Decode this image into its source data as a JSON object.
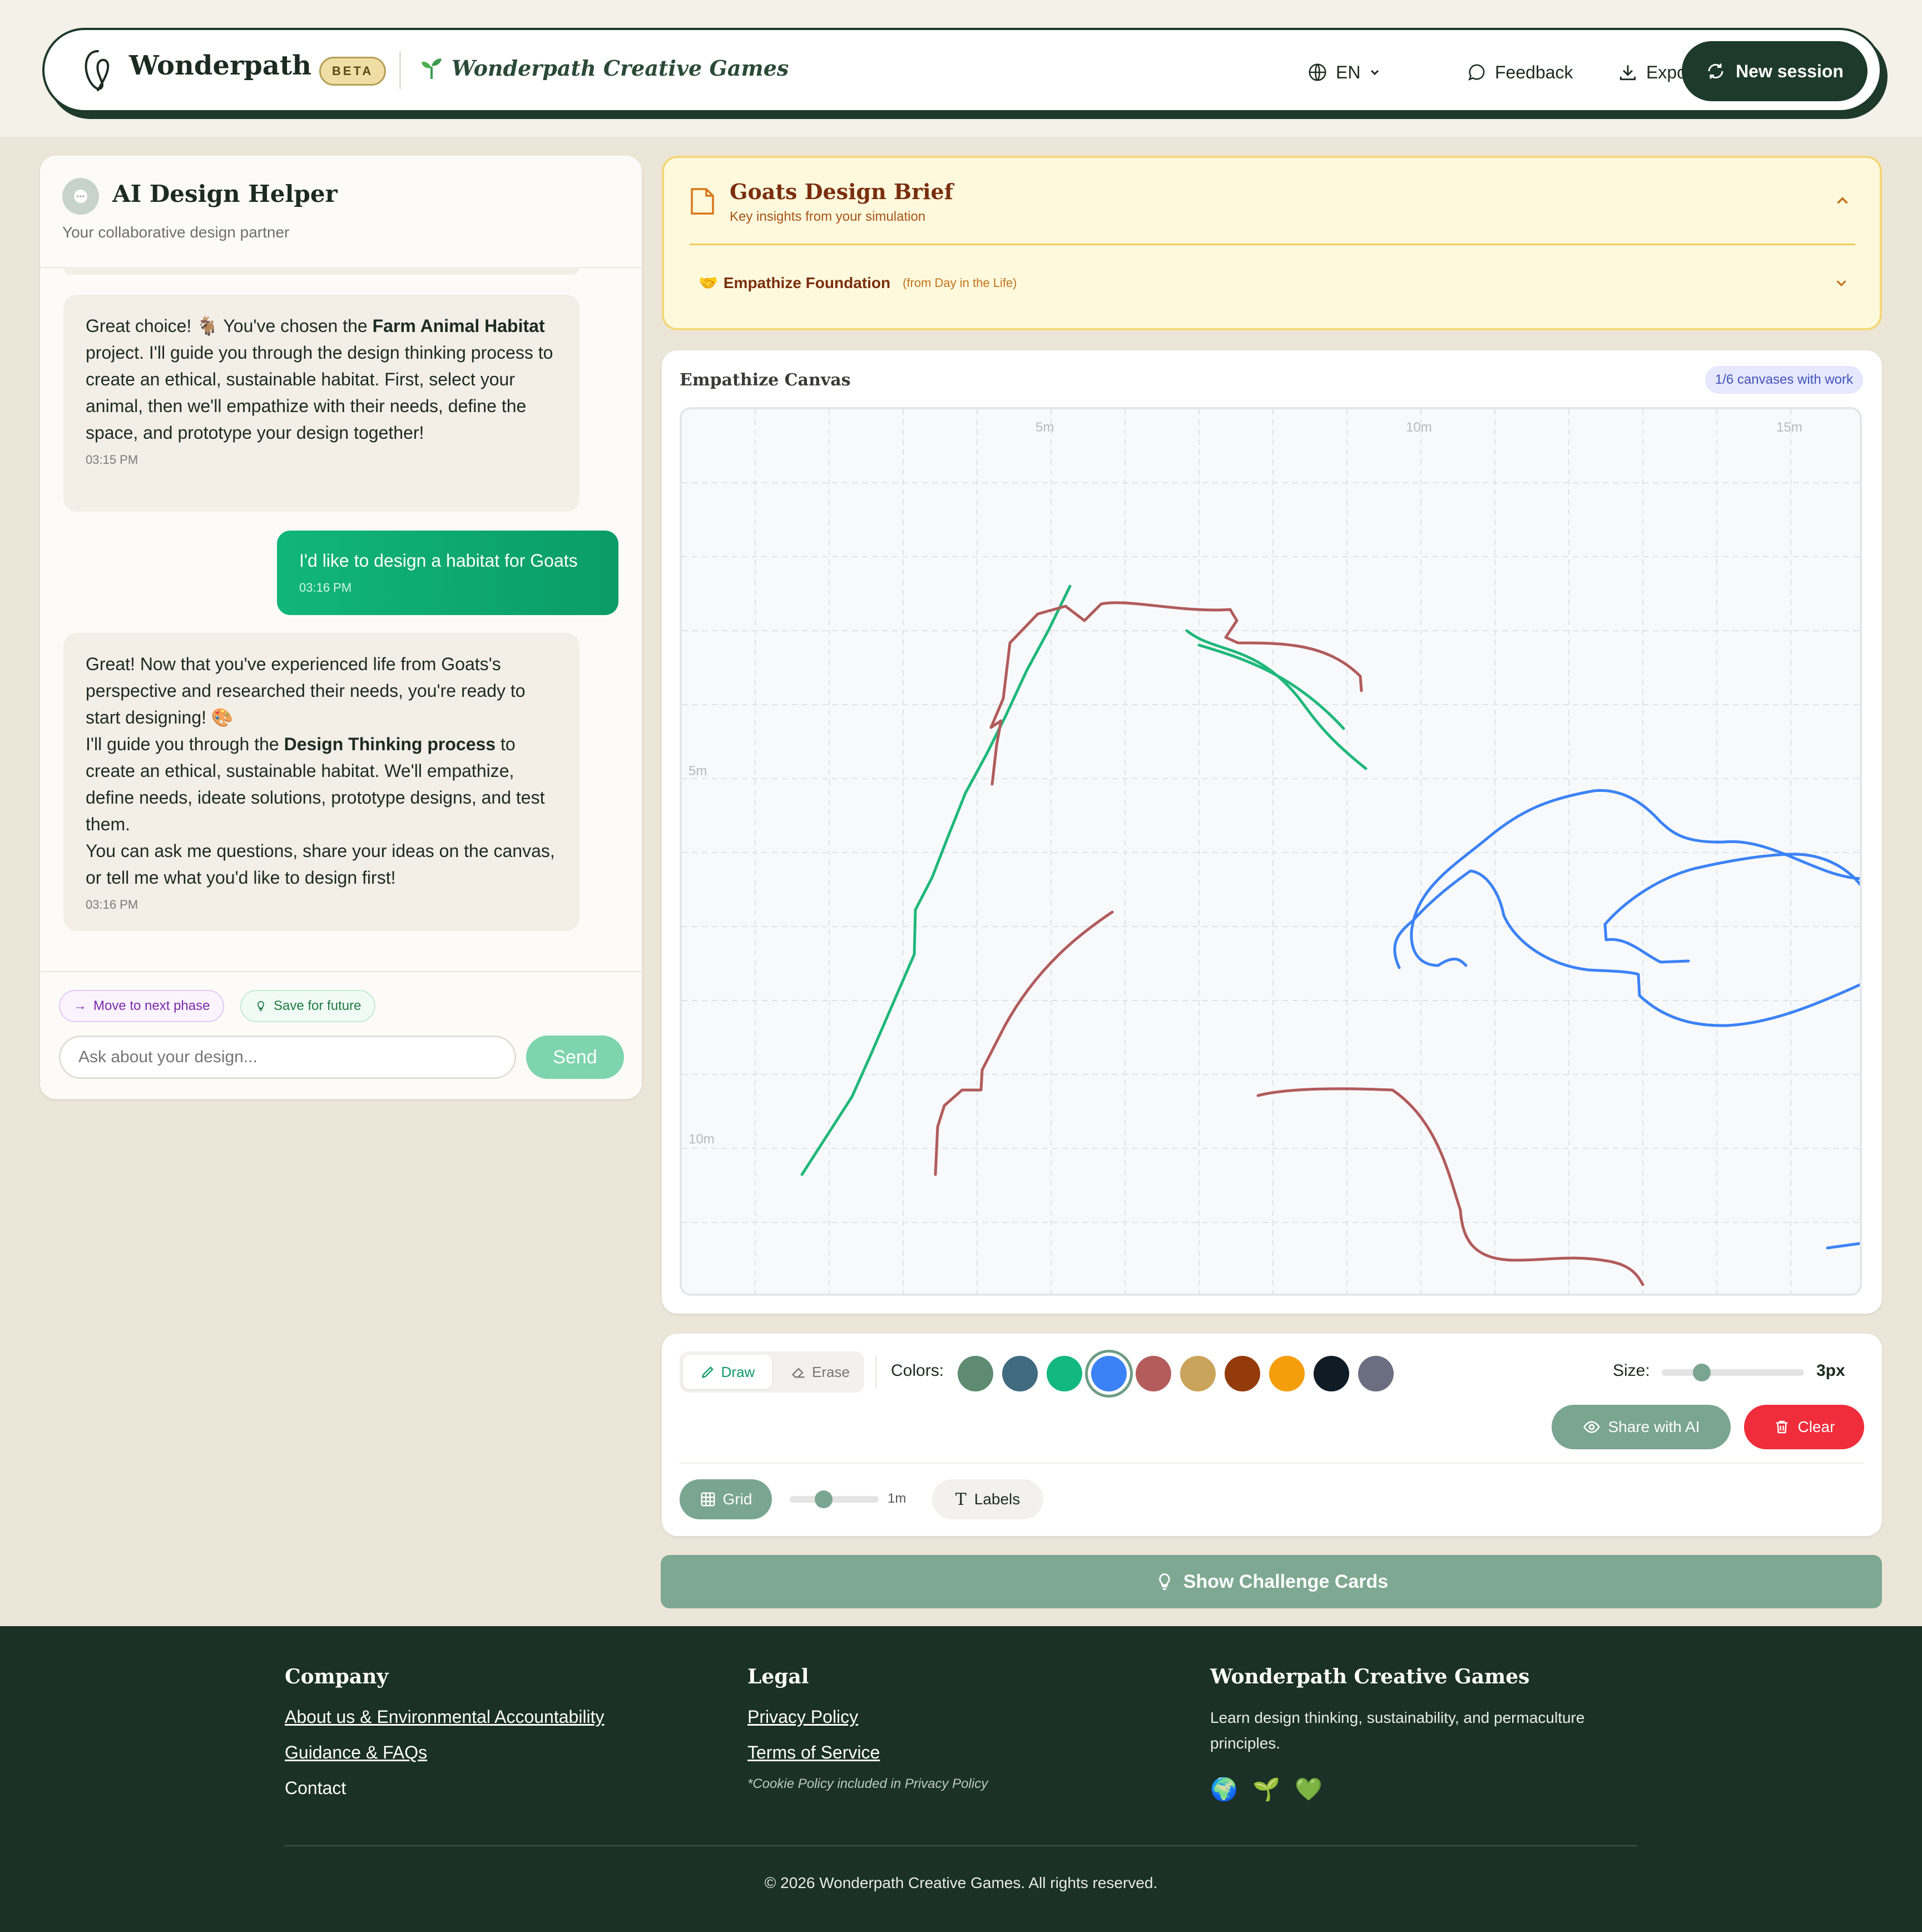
{
  "header": {
    "brand": "Wonderpath",
    "badge": "BETA",
    "subbrand": "Wonderpath Creative Games",
    "language": "EN",
    "feedback": "Feedback",
    "export": "Export",
    "new_session": "New session"
  },
  "chat": {
    "title": "AI Design Helper",
    "subtitle": "Your collaborative design partner",
    "messages": [
      {
        "role": "ai",
        "p1": "Great choice! 🐐 You've chosen the ",
        "b1": "Farm Animal Habitat",
        "p2": " project. I'll guide you through the design thinking process to create an ethical, sustainable habitat. First, select your animal, then we'll empathize with their needs, define the space, and prototype your design together!",
        "time": "03:15 PM"
      },
      {
        "role": "user",
        "text": "I'd like to design a habitat for Goats",
        "time": "03:16 PM"
      },
      {
        "role": "ai",
        "p1": "Great! Now that you've experienced life from Goats's perspective and researched their needs, you're ready to start designing! 🎨",
        "p2a": "I'll guide you through the ",
        "b2": "Design Thinking process",
        "p2b": " to create an ethical, sustainable habitat. We'll empathize, define needs, ideate solutions, prototype designs, and test them.",
        "p3": "You can ask me questions, share your ideas on the canvas, or tell me what you'd like to design first!",
        "time": "03:16 PM"
      }
    ],
    "chip_next": "Move to next phase",
    "chip_save": "Save for future",
    "input_placeholder": "Ask about your design...",
    "send": "Send"
  },
  "brief": {
    "title": "Goats Design Brief",
    "subtitle": "Key insights from your simulation",
    "item_emoji": "🤝",
    "item_label": "Empathize Foundation",
    "item_source": "(from Day in the Life)"
  },
  "canvas": {
    "title": "Empathize Canvas",
    "badge": "1/6 canvases with work",
    "ruler_x": [
      "5m",
      "10m",
      "15m"
    ],
    "ruler_y": [
      "5m",
      "10m"
    ]
  },
  "toolbar": {
    "draw": "Draw",
    "erase": "Erase",
    "colors_label": "Colors:",
    "colors": [
      "#5e8b72",
      "#3f6a80",
      "#12b880",
      "#3b82f6",
      "#b45c5c",
      "#c9a45a",
      "#943b0c",
      "#f59e0b",
      "#0f1c26",
      "#6b6e80"
    ],
    "selected_color": "#3b82f6",
    "size_label": "Size:",
    "size_value": "3px",
    "size_level": 0.25,
    "share_ai": "Share with AI",
    "clear": "Clear",
    "grid": "Grid",
    "grid_size": "1m",
    "grid_level": 0.35,
    "labels": "Labels"
  },
  "challenge": "Show Challenge Cards",
  "footer": {
    "company_title": "Company",
    "company_links": [
      "About us & Environmental Accountability",
      "Guidance & FAQs"
    ],
    "contact": "Contact",
    "legal_title": "Legal",
    "legal_links": [
      "Privacy Policy",
      "Terms of Service"
    ],
    "cookie_note": "*Cookie Policy included in Privacy Policy",
    "brand_title": "Wonderpath Creative Games",
    "brand_desc": "Learn design thinking, sustainability, and permaculture principles.",
    "emojis": [
      "🌍",
      "🌱",
      "💚"
    ],
    "copyright": "© 2026 Wonderpath Creative Games. All rights reserved."
  }
}
